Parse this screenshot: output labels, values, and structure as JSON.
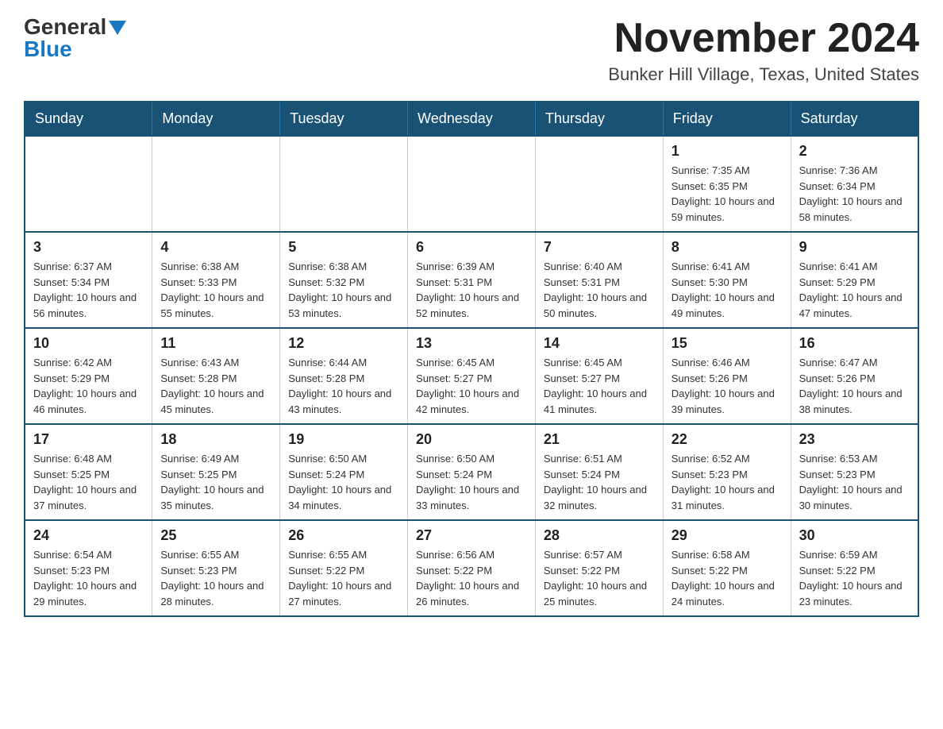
{
  "logo": {
    "general": "General",
    "blue": "Blue"
  },
  "header": {
    "month": "November 2024",
    "location": "Bunker Hill Village, Texas, United States"
  },
  "weekdays": [
    "Sunday",
    "Monday",
    "Tuesday",
    "Wednesday",
    "Thursday",
    "Friday",
    "Saturday"
  ],
  "weeks": [
    [
      {
        "day": "",
        "info": ""
      },
      {
        "day": "",
        "info": ""
      },
      {
        "day": "",
        "info": ""
      },
      {
        "day": "",
        "info": ""
      },
      {
        "day": "",
        "info": ""
      },
      {
        "day": "1",
        "info": "Sunrise: 7:35 AM\nSunset: 6:35 PM\nDaylight: 10 hours\nand 59 minutes."
      },
      {
        "day": "2",
        "info": "Sunrise: 7:36 AM\nSunset: 6:34 PM\nDaylight: 10 hours\nand 58 minutes."
      }
    ],
    [
      {
        "day": "3",
        "info": "Sunrise: 6:37 AM\nSunset: 5:34 PM\nDaylight: 10 hours\nand 56 minutes."
      },
      {
        "day": "4",
        "info": "Sunrise: 6:38 AM\nSunset: 5:33 PM\nDaylight: 10 hours\nand 55 minutes."
      },
      {
        "day": "5",
        "info": "Sunrise: 6:38 AM\nSunset: 5:32 PM\nDaylight: 10 hours\nand 53 minutes."
      },
      {
        "day": "6",
        "info": "Sunrise: 6:39 AM\nSunset: 5:31 PM\nDaylight: 10 hours\nand 52 minutes."
      },
      {
        "day": "7",
        "info": "Sunrise: 6:40 AM\nSunset: 5:31 PM\nDaylight: 10 hours\nand 50 minutes."
      },
      {
        "day": "8",
        "info": "Sunrise: 6:41 AM\nSunset: 5:30 PM\nDaylight: 10 hours\nand 49 minutes."
      },
      {
        "day": "9",
        "info": "Sunrise: 6:41 AM\nSunset: 5:29 PM\nDaylight: 10 hours\nand 47 minutes."
      }
    ],
    [
      {
        "day": "10",
        "info": "Sunrise: 6:42 AM\nSunset: 5:29 PM\nDaylight: 10 hours\nand 46 minutes."
      },
      {
        "day": "11",
        "info": "Sunrise: 6:43 AM\nSunset: 5:28 PM\nDaylight: 10 hours\nand 45 minutes."
      },
      {
        "day": "12",
        "info": "Sunrise: 6:44 AM\nSunset: 5:28 PM\nDaylight: 10 hours\nand 43 minutes."
      },
      {
        "day": "13",
        "info": "Sunrise: 6:45 AM\nSunset: 5:27 PM\nDaylight: 10 hours\nand 42 minutes."
      },
      {
        "day": "14",
        "info": "Sunrise: 6:45 AM\nSunset: 5:27 PM\nDaylight: 10 hours\nand 41 minutes."
      },
      {
        "day": "15",
        "info": "Sunrise: 6:46 AM\nSunset: 5:26 PM\nDaylight: 10 hours\nand 39 minutes."
      },
      {
        "day": "16",
        "info": "Sunrise: 6:47 AM\nSunset: 5:26 PM\nDaylight: 10 hours\nand 38 minutes."
      }
    ],
    [
      {
        "day": "17",
        "info": "Sunrise: 6:48 AM\nSunset: 5:25 PM\nDaylight: 10 hours\nand 37 minutes."
      },
      {
        "day": "18",
        "info": "Sunrise: 6:49 AM\nSunset: 5:25 PM\nDaylight: 10 hours\nand 35 minutes."
      },
      {
        "day": "19",
        "info": "Sunrise: 6:50 AM\nSunset: 5:24 PM\nDaylight: 10 hours\nand 34 minutes."
      },
      {
        "day": "20",
        "info": "Sunrise: 6:50 AM\nSunset: 5:24 PM\nDaylight: 10 hours\nand 33 minutes."
      },
      {
        "day": "21",
        "info": "Sunrise: 6:51 AM\nSunset: 5:24 PM\nDaylight: 10 hours\nand 32 minutes."
      },
      {
        "day": "22",
        "info": "Sunrise: 6:52 AM\nSunset: 5:23 PM\nDaylight: 10 hours\nand 31 minutes."
      },
      {
        "day": "23",
        "info": "Sunrise: 6:53 AM\nSunset: 5:23 PM\nDaylight: 10 hours\nand 30 minutes."
      }
    ],
    [
      {
        "day": "24",
        "info": "Sunrise: 6:54 AM\nSunset: 5:23 PM\nDaylight: 10 hours\nand 29 minutes."
      },
      {
        "day": "25",
        "info": "Sunrise: 6:55 AM\nSunset: 5:23 PM\nDaylight: 10 hours\nand 28 minutes."
      },
      {
        "day": "26",
        "info": "Sunrise: 6:55 AM\nSunset: 5:22 PM\nDaylight: 10 hours\nand 27 minutes."
      },
      {
        "day": "27",
        "info": "Sunrise: 6:56 AM\nSunset: 5:22 PM\nDaylight: 10 hours\nand 26 minutes."
      },
      {
        "day": "28",
        "info": "Sunrise: 6:57 AM\nSunset: 5:22 PM\nDaylight: 10 hours\nand 25 minutes."
      },
      {
        "day": "29",
        "info": "Sunrise: 6:58 AM\nSunset: 5:22 PM\nDaylight: 10 hours\nand 24 minutes."
      },
      {
        "day": "30",
        "info": "Sunrise: 6:59 AM\nSunset: 5:22 PM\nDaylight: 10 hours\nand 23 minutes."
      }
    ]
  ]
}
